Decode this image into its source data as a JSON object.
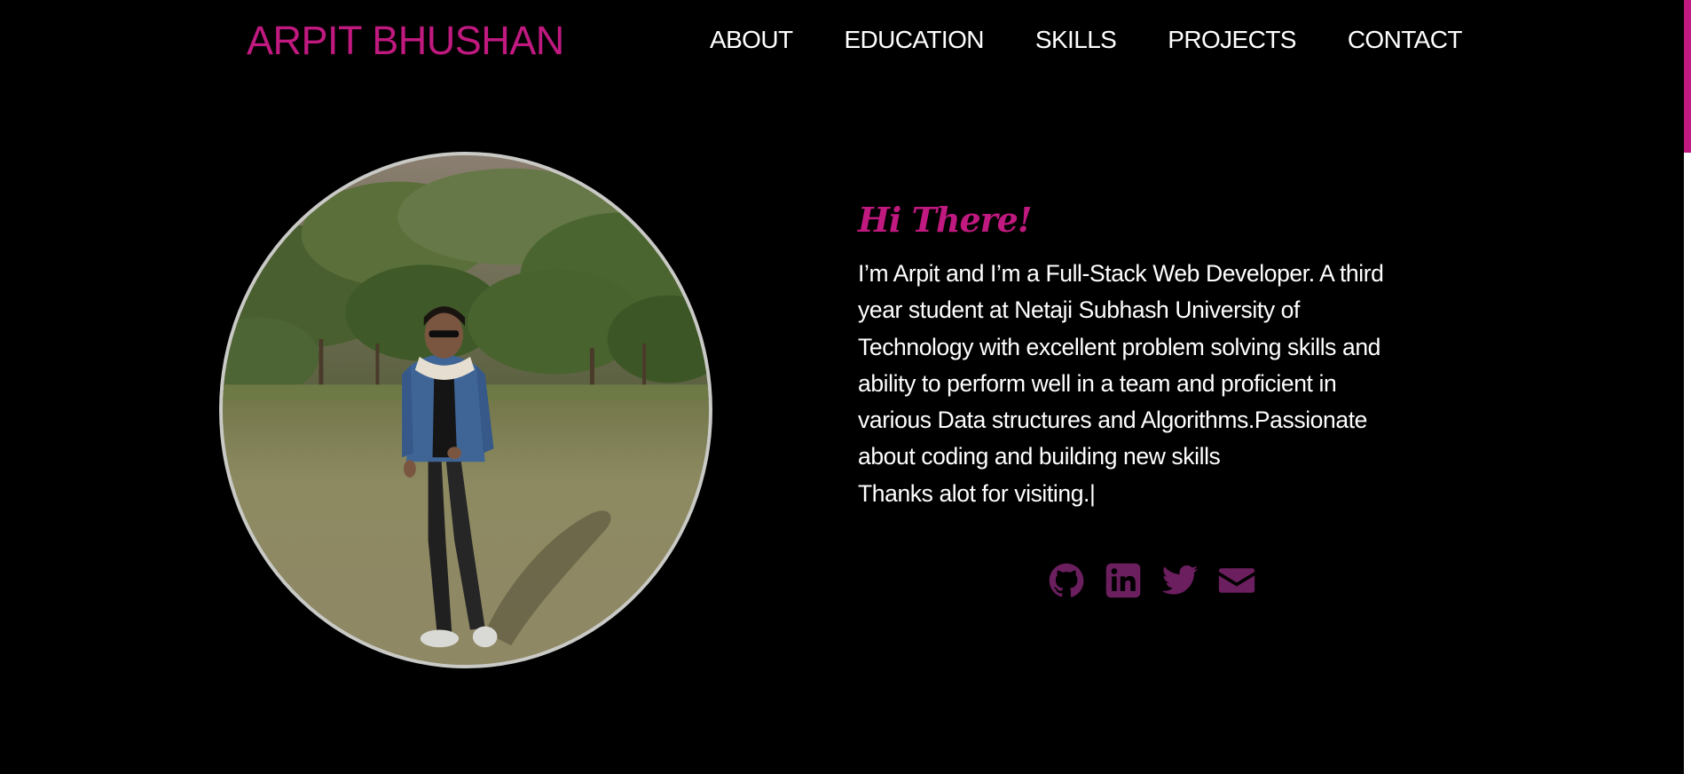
{
  "header": {
    "logo": "ARPIT BHUSHAN",
    "nav": [
      {
        "label": "ABOUT"
      },
      {
        "label": "EDUCATION"
      },
      {
        "label": "SKILLS"
      },
      {
        "label": "PROJECTS"
      },
      {
        "label": "CONTACT"
      }
    ]
  },
  "hero": {
    "greeting": "Hi There!",
    "bio_lines": [
      "I’m Arpit and I’m a Full-Stack Web Developer. A third",
      "year student at Netaji Subhash University of",
      "Technology with excellent problem solving skills and",
      "ability to perform well in a team and proficient in",
      "various Data structures and Algorithms.Passionate",
      "about coding and building new skills",
      "Thanks alot for visiting.|"
    ],
    "socials": [
      {
        "icon": "github-icon"
      },
      {
        "icon": "linkedin-icon"
      },
      {
        "icon": "twitter-icon"
      },
      {
        "icon": "envelope-icon"
      }
    ]
  },
  "scroll": {
    "position_fraction": 0.0
  },
  "colors": {
    "accent": "#c0197f",
    "icon": "#6b1f5e",
    "background": "#000000",
    "text": "#ffffff",
    "avatar_border": "#c9c9c6"
  }
}
